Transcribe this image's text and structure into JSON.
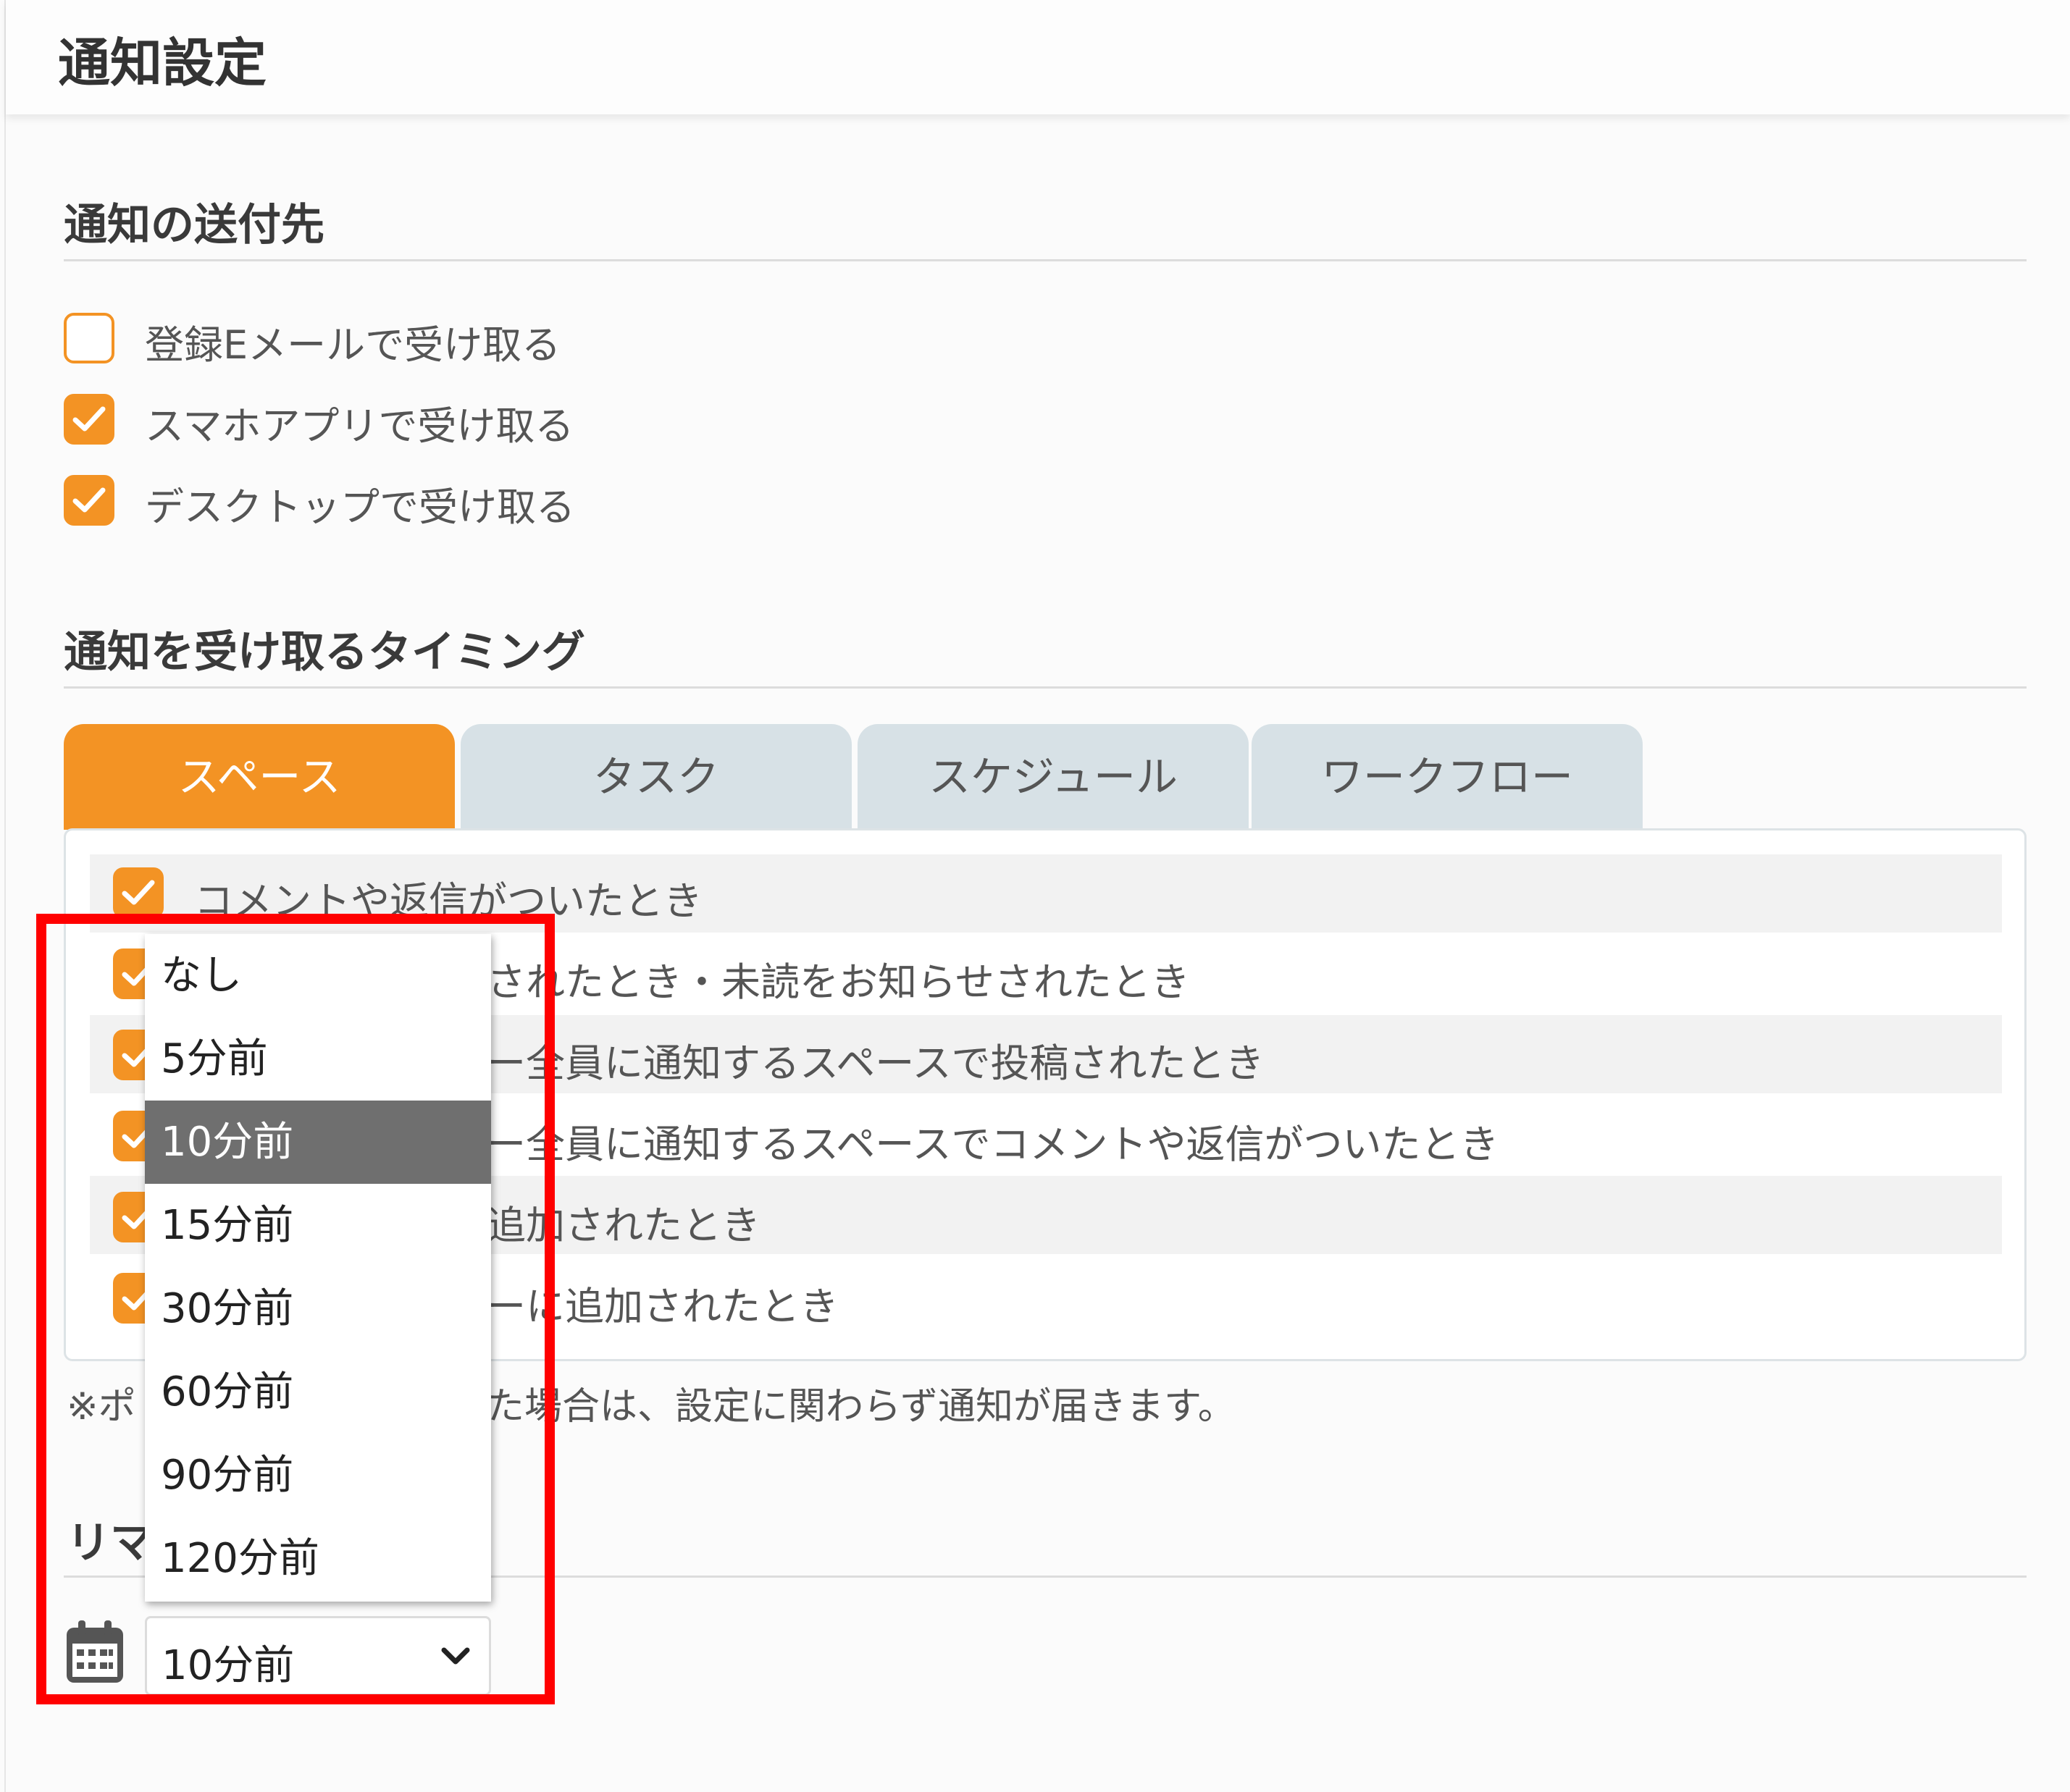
{
  "page_title": "通知設定",
  "destination": {
    "title": "通知の送付先",
    "items": [
      {
        "label": "登録Eメールで受け取る",
        "checked": false
      },
      {
        "label": "スマホアプリで受け取る",
        "checked": true
      },
      {
        "label": "デスクトップで受け取る",
        "checked": true
      }
    ]
  },
  "timing": {
    "title": "通知を受け取るタイミング",
    "tabs": [
      "スペース",
      "タスク",
      "スケジュール",
      "ワークフロー"
    ],
    "active_tab": "スペース",
    "rows": [
      {
        "label": "コメントや返信がついたとき",
        "checked": true
      },
      {
        "label": "されたとき・未読をお知らせされたとき",
        "checked": true
      },
      {
        "label": "ー全員に通知するスペースで投稿されたとき",
        "checked": true
      },
      {
        "label": "ー全員に通知するスペースでコメントや返信がついたとき",
        "checked": true
      },
      {
        "label": "追加されたとき",
        "checked": true
      },
      {
        "label": "ーに追加されたとき",
        "checked": true
      }
    ],
    "footnote_prefix": "※ポ",
    "footnote_suffix": "た場合は、設定に関わらず通知が届きます。"
  },
  "reminder": {
    "title_fragment": "リマ",
    "options": [
      "なし",
      "5分前",
      "10分前",
      "15分前",
      "30分前",
      "60分前",
      "90分前",
      "120分前"
    ],
    "selected": "10分前"
  },
  "colors": {
    "accent": "#f39324",
    "tab_inactive": "#d7e1e6",
    "highlight": "#ff0000",
    "selected_option": "#6f6f6f"
  },
  "icons": [
    "check-icon",
    "calendar-icon",
    "chevron-down-icon"
  ]
}
